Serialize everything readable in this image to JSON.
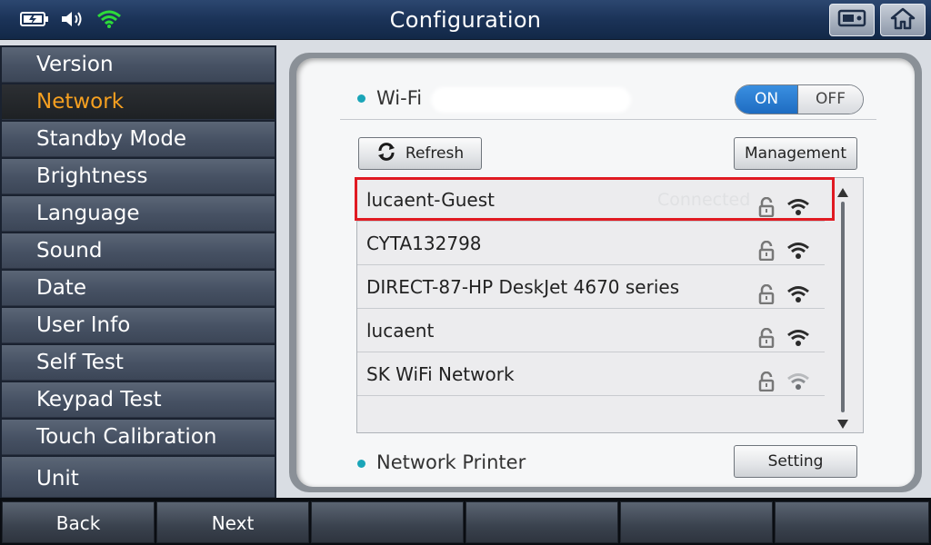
{
  "header": {
    "title": "Configuration",
    "icons": [
      "battery-charging-icon",
      "speaker-icon",
      "wifi-signal-icon"
    ],
    "buttons": [
      "screen-capture-icon",
      "home-icon"
    ]
  },
  "sidebar": {
    "items": [
      {
        "label": "Version",
        "active": false
      },
      {
        "label": "Network",
        "active": true
      },
      {
        "label": "Standby Mode",
        "active": false
      },
      {
        "label": "Brightness",
        "active": false
      },
      {
        "label": "Language",
        "active": false
      },
      {
        "label": "Sound",
        "active": false
      },
      {
        "label": "Date",
        "active": false
      },
      {
        "label": "User Info",
        "active": false
      },
      {
        "label": "Self Test",
        "active": false
      },
      {
        "label": "Keypad Test",
        "active": false
      },
      {
        "label": "Touch Calibration",
        "active": false
      },
      {
        "label": "Unit",
        "active": false
      }
    ]
  },
  "wifi": {
    "label": "Wi-Fi",
    "toggle_on": "ON",
    "toggle_off": "OFF",
    "state": "ON",
    "refresh_label": "Refresh",
    "management_label": "Management",
    "networks": [
      {
        "ssid": "lucaent-Guest",
        "status": "Connected",
        "locked": true,
        "signal": "strong",
        "selected": true
      },
      {
        "ssid": "CYTA132798",
        "status": "",
        "locked": true,
        "signal": "strong",
        "selected": false
      },
      {
        "ssid": "DIRECT-87-HP DeskJet 4670 series",
        "status": "",
        "locked": true,
        "signal": "strong",
        "selected": false
      },
      {
        "ssid": "lucaent",
        "status": "",
        "locked": true,
        "signal": "strong",
        "selected": false
      },
      {
        "ssid": "SK WiFi Network",
        "status": "",
        "locked": true,
        "signal": "weak",
        "selected": false
      }
    ]
  },
  "network_printer": {
    "label": "Network Printer",
    "setting_label": "Setting"
  },
  "footer": {
    "buttons": [
      "Back",
      "Next",
      "",
      "",
      "",
      ""
    ]
  },
  "colors": {
    "accent_active": "#f6a020",
    "toggle_on": "#2a7fd6",
    "highlight": "#e01a22",
    "bullet": "#1aa5b8"
  }
}
